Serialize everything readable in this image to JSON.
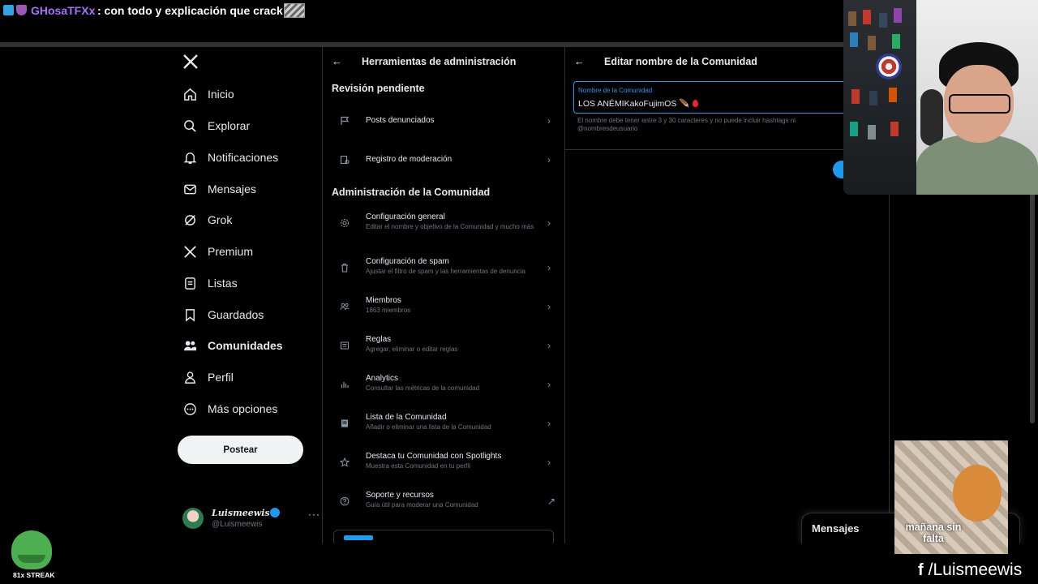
{
  "stream_chat": {
    "username": "GHosaTFXx",
    "message": ": con todo y explicación que crack"
  },
  "sidebar": {
    "items": [
      {
        "label": "Inicio",
        "icon": "home-icon"
      },
      {
        "label": "Explorar",
        "icon": "search-icon"
      },
      {
        "label": "Notificaciones",
        "icon": "bell-icon"
      },
      {
        "label": "Mensajes",
        "icon": "mail-icon"
      },
      {
        "label": "Grok",
        "icon": "grok-icon"
      },
      {
        "label": "Premium",
        "icon": "x-icon"
      },
      {
        "label": "Listas",
        "icon": "list-icon"
      },
      {
        "label": "Guardados",
        "icon": "bookmark-icon"
      },
      {
        "label": "Comunidades",
        "icon": "people-icon",
        "active": true
      },
      {
        "label": "Perfil",
        "icon": "person-icon"
      },
      {
        "label": "Más opciones",
        "icon": "more-circle-icon"
      }
    ],
    "post_button": "Postear",
    "account": {
      "display_name": "Luismeewis",
      "handle": "@Luismeewis",
      "more": "···"
    }
  },
  "admin": {
    "header": {
      "back": "←",
      "title": "Herramientas de administración"
    },
    "pending_title": "Revisión pendiente",
    "pending_items": [
      {
        "title": "Posts denunciados",
        "icon": "flag-icon"
      },
      {
        "title": "Registro de moderación",
        "icon": "log-icon"
      }
    ],
    "community_title": "Administración de la Comunidad",
    "community_items": [
      {
        "title": "Configuración general",
        "subtitle": "Editar el nombre y objetivo de la Comunidad y mucho más",
        "icon": "gear-icon"
      },
      {
        "title": "Configuración de spam",
        "subtitle": "Ajustar el filtro de spam y las herramientas de denuncia",
        "icon": "trash-icon"
      },
      {
        "title": "Miembros",
        "subtitle": "1863 miembros",
        "icon": "members-icon"
      },
      {
        "title": "Reglas",
        "subtitle": "Agregar, eliminar o editar reglas",
        "icon": "rules-icon"
      },
      {
        "title": "Analytics",
        "subtitle": "Consultar las métricas de la comunidad",
        "icon": "analytics-icon"
      },
      {
        "title": "Lista de la Comunidad",
        "subtitle": "Añadir o eliminar una lista de la Comunidad",
        "icon": "list-icon"
      },
      {
        "title": "Destaca tu Comunidad con Spotlights",
        "subtitle": "Muestra esta Comunidad en tu perfil",
        "icon": "star-icon"
      },
      {
        "title": "Soporte y recursos",
        "subtitle": "Guía útil para moderar una Comunidad",
        "icon": "help-icon",
        "external": true
      }
    ]
  },
  "edit": {
    "header": {
      "back": "←",
      "title": "Editar nombre de la Comunidad"
    },
    "field_label": "Nombre de la Comunidad",
    "field_value": "LOS ANÉMIKakoFujimOS",
    "field_emoji": "🪶",
    "hint": "El nombre debe tener entre 3 y 30 caracteres y no puede incluir hashtags ni @nombresdeusuario"
  },
  "messages_drawer": {
    "label": "Mensajes"
  },
  "overlays": {
    "cat_caption": "mañana sin falta",
    "streak_label": "81x STREAK",
    "social_handle": "/Luismeewis"
  },
  "colors": {
    "accent": "#1d9bf0",
    "background": "#000000",
    "text": "#e7e9ea",
    "muted": "#71767b",
    "chat_username": "#a970ff"
  }
}
